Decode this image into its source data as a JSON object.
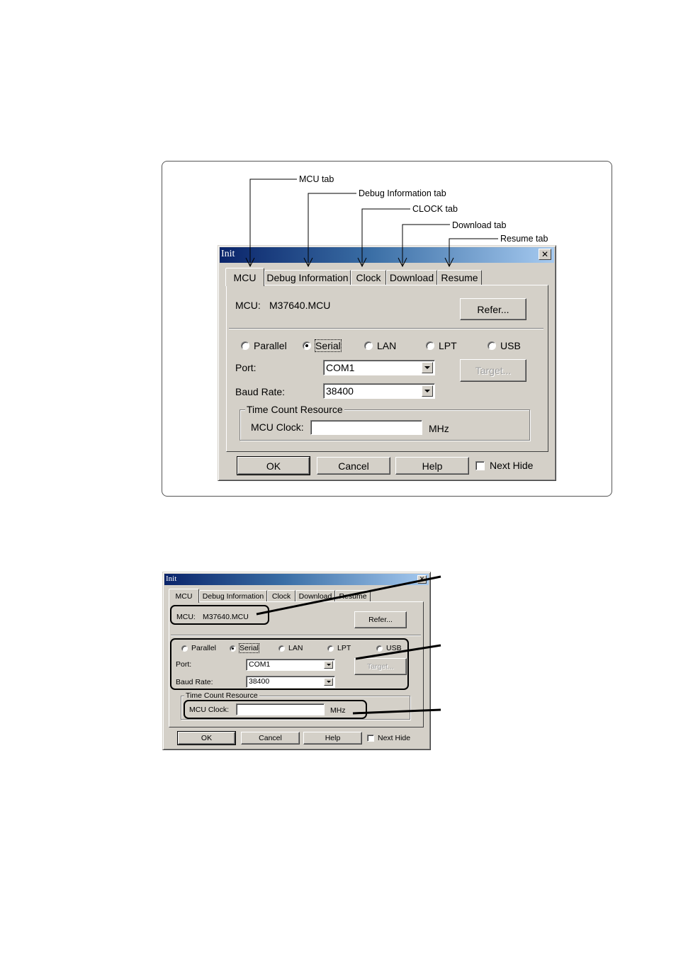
{
  "figure1": {
    "callouts": [
      {
        "id": "mcu",
        "label": "MCU tab"
      },
      {
        "id": "debug",
        "label": "Debug Information  tab"
      },
      {
        "id": "clock",
        "label": "CLOCK tab"
      },
      {
        "id": "download",
        "label": "Download tab"
      },
      {
        "id": "resume",
        "label": "Resume tab"
      }
    ]
  },
  "dialog": {
    "title": "Init",
    "close_icon": "close-icon",
    "tabs": [
      {
        "label": "MCU",
        "active": true
      },
      {
        "label": "Debug Information",
        "active": false
      },
      {
        "label": "Clock",
        "active": false
      },
      {
        "label": "Download",
        "active": false
      },
      {
        "label": "Resume",
        "active": false
      }
    ],
    "mcu_label": "MCU:",
    "mcu_value": "M37640.MCU",
    "refer_button": "Refer...",
    "interfaces": [
      {
        "label": "Parallel",
        "checked": false
      },
      {
        "label": "Serial",
        "checked": true
      },
      {
        "label": "LAN",
        "checked": false
      },
      {
        "label": "LPT",
        "checked": false
      },
      {
        "label": "USB",
        "checked": false
      }
    ],
    "port_label": "Port:",
    "port_value": "COM1",
    "target_button": "Target...",
    "baud_label": "Baud Rate:",
    "baud_value": "38400",
    "group_title": "Time Count Resource",
    "mcu_clock_label": "MCU Clock:",
    "mcu_clock_value": "",
    "mcu_clock_unit": "MHz",
    "ok_button": "OK",
    "cancel_button": "Cancel",
    "help_button": "Help",
    "next_hide_label": "Next Hide",
    "next_hide_checked": false
  }
}
